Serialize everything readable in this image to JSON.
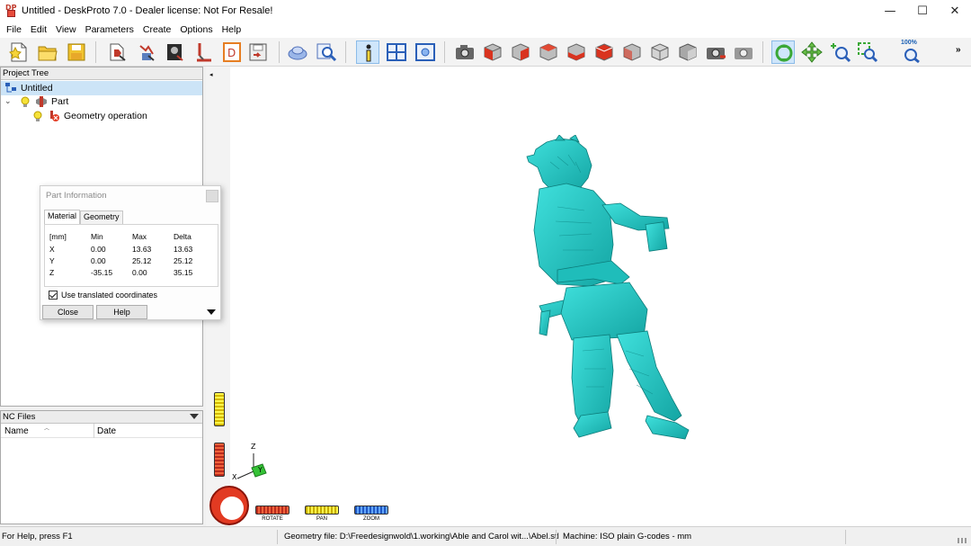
{
  "window": {
    "title": "Untitled - DeskProto 7.0 - Dealer license: Not For Resale!",
    "logo_text": "DP",
    "controls": {
      "minimize": "—",
      "maximize": "☐",
      "close": "✕"
    }
  },
  "menu": [
    "File",
    "Edit",
    "View",
    "Parameters",
    "Create",
    "Options",
    "Help"
  ],
  "toolbar": {
    "zoom_label": "100%",
    "more": "»",
    "buttons": [
      "new-project",
      "open-project",
      "save-project",
      "import-part",
      "part-wizard",
      "vector-wizard",
      "bitmap-wizard",
      "dxf-import",
      "save-gcode",
      "view-part",
      "search",
      "part-information",
      "layout-view",
      "visual-view",
      "screenshot",
      "view-front",
      "view-back",
      "view-left",
      "view-right",
      "view-top",
      "view-bottom",
      "view-iso",
      "view-3d",
      "render-image",
      "print-image",
      "rotate-mode",
      "pan-mode",
      "zoom-mode",
      "zoom-window",
      "zoom-100"
    ]
  },
  "project_tree": {
    "header": "Project Tree",
    "items": [
      {
        "label": "Untitled",
        "selected": true
      },
      {
        "label": "Part",
        "expander": "⌄"
      },
      {
        "label": "Geometry operation"
      }
    ]
  },
  "nc_files": {
    "header": "NC Files",
    "columns": [
      "Name",
      "Date"
    ]
  },
  "part_information": {
    "title": "Part Information",
    "tabs": [
      "Material",
      "Geometry"
    ],
    "active_tab": "Material",
    "headers": [
      "[mm]",
      "Min",
      "Max",
      "Delta"
    ],
    "rows": [
      [
        "X",
        "0.00",
        "13.63",
        "13.63"
      ],
      [
        "Y",
        "0.00",
        "25.12",
        "25.12"
      ],
      [
        "Z",
        "-35.15",
        "0.00",
        "35.15"
      ]
    ],
    "use_translated_label": "Use translated coordinates",
    "use_translated_checked": true,
    "close_label": "Close",
    "help_label": "Help"
  },
  "viewport": {
    "collapse_caret": "◂",
    "model_color": "#20c2bf",
    "axes": {
      "z": "Z",
      "x": "X",
      "y": "Y"
    },
    "controls": {
      "rotate": "ROTATE",
      "pan": "PAN",
      "zoom": "ZOOM"
    }
  },
  "status": {
    "help": "For Help, press F1",
    "geometry_file": "Geometry file: D:\\Freedesignwold\\1.working\\Able and Carol wit...\\Abel.stl",
    "machine": "Machine: ISO plain G-codes - mm"
  }
}
